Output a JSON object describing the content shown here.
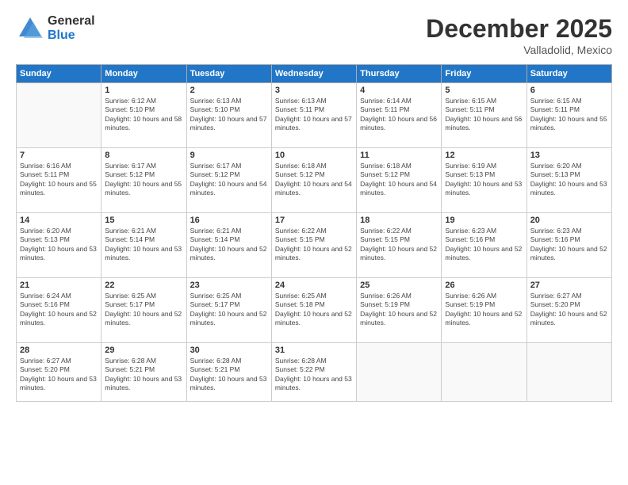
{
  "logo": {
    "general": "General",
    "blue": "Blue"
  },
  "title": "December 2025",
  "subtitle": "Valladolid, Mexico",
  "days_of_week": [
    "Sunday",
    "Monday",
    "Tuesday",
    "Wednesday",
    "Thursday",
    "Friday",
    "Saturday"
  ],
  "weeks": [
    [
      {
        "day": "",
        "sunrise": "",
        "sunset": "",
        "daylight": ""
      },
      {
        "day": "1",
        "sunrise": "Sunrise: 6:12 AM",
        "sunset": "Sunset: 5:10 PM",
        "daylight": "Daylight: 10 hours and 58 minutes."
      },
      {
        "day": "2",
        "sunrise": "Sunrise: 6:13 AM",
        "sunset": "Sunset: 5:10 PM",
        "daylight": "Daylight: 10 hours and 57 minutes."
      },
      {
        "day": "3",
        "sunrise": "Sunrise: 6:13 AM",
        "sunset": "Sunset: 5:11 PM",
        "daylight": "Daylight: 10 hours and 57 minutes."
      },
      {
        "day": "4",
        "sunrise": "Sunrise: 6:14 AM",
        "sunset": "Sunset: 5:11 PM",
        "daylight": "Daylight: 10 hours and 56 minutes."
      },
      {
        "day": "5",
        "sunrise": "Sunrise: 6:15 AM",
        "sunset": "Sunset: 5:11 PM",
        "daylight": "Daylight: 10 hours and 56 minutes."
      },
      {
        "day": "6",
        "sunrise": "Sunrise: 6:15 AM",
        "sunset": "Sunset: 5:11 PM",
        "daylight": "Daylight: 10 hours and 55 minutes."
      }
    ],
    [
      {
        "day": "7",
        "sunrise": "Sunrise: 6:16 AM",
        "sunset": "Sunset: 5:11 PM",
        "daylight": "Daylight: 10 hours and 55 minutes."
      },
      {
        "day": "8",
        "sunrise": "Sunrise: 6:17 AM",
        "sunset": "Sunset: 5:12 PM",
        "daylight": "Daylight: 10 hours and 55 minutes."
      },
      {
        "day": "9",
        "sunrise": "Sunrise: 6:17 AM",
        "sunset": "Sunset: 5:12 PM",
        "daylight": "Daylight: 10 hours and 54 minutes."
      },
      {
        "day": "10",
        "sunrise": "Sunrise: 6:18 AM",
        "sunset": "Sunset: 5:12 PM",
        "daylight": "Daylight: 10 hours and 54 minutes."
      },
      {
        "day": "11",
        "sunrise": "Sunrise: 6:18 AM",
        "sunset": "Sunset: 5:12 PM",
        "daylight": "Daylight: 10 hours and 54 minutes."
      },
      {
        "day": "12",
        "sunrise": "Sunrise: 6:19 AM",
        "sunset": "Sunset: 5:13 PM",
        "daylight": "Daylight: 10 hours and 53 minutes."
      },
      {
        "day": "13",
        "sunrise": "Sunrise: 6:20 AM",
        "sunset": "Sunset: 5:13 PM",
        "daylight": "Daylight: 10 hours and 53 minutes."
      }
    ],
    [
      {
        "day": "14",
        "sunrise": "Sunrise: 6:20 AM",
        "sunset": "Sunset: 5:13 PM",
        "daylight": "Daylight: 10 hours and 53 minutes."
      },
      {
        "day": "15",
        "sunrise": "Sunrise: 6:21 AM",
        "sunset": "Sunset: 5:14 PM",
        "daylight": "Daylight: 10 hours and 53 minutes."
      },
      {
        "day": "16",
        "sunrise": "Sunrise: 6:21 AM",
        "sunset": "Sunset: 5:14 PM",
        "daylight": "Daylight: 10 hours and 52 minutes."
      },
      {
        "day": "17",
        "sunrise": "Sunrise: 6:22 AM",
        "sunset": "Sunset: 5:15 PM",
        "daylight": "Daylight: 10 hours and 52 minutes."
      },
      {
        "day": "18",
        "sunrise": "Sunrise: 6:22 AM",
        "sunset": "Sunset: 5:15 PM",
        "daylight": "Daylight: 10 hours and 52 minutes."
      },
      {
        "day": "19",
        "sunrise": "Sunrise: 6:23 AM",
        "sunset": "Sunset: 5:16 PM",
        "daylight": "Daylight: 10 hours and 52 minutes."
      },
      {
        "day": "20",
        "sunrise": "Sunrise: 6:23 AM",
        "sunset": "Sunset: 5:16 PM",
        "daylight": "Daylight: 10 hours and 52 minutes."
      }
    ],
    [
      {
        "day": "21",
        "sunrise": "Sunrise: 6:24 AM",
        "sunset": "Sunset: 5:16 PM",
        "daylight": "Daylight: 10 hours and 52 minutes."
      },
      {
        "day": "22",
        "sunrise": "Sunrise: 6:25 AM",
        "sunset": "Sunset: 5:17 PM",
        "daylight": "Daylight: 10 hours and 52 minutes."
      },
      {
        "day": "23",
        "sunrise": "Sunrise: 6:25 AM",
        "sunset": "Sunset: 5:17 PM",
        "daylight": "Daylight: 10 hours and 52 minutes."
      },
      {
        "day": "24",
        "sunrise": "Sunrise: 6:25 AM",
        "sunset": "Sunset: 5:18 PM",
        "daylight": "Daylight: 10 hours and 52 minutes."
      },
      {
        "day": "25",
        "sunrise": "Sunrise: 6:26 AM",
        "sunset": "Sunset: 5:19 PM",
        "daylight": "Daylight: 10 hours and 52 minutes."
      },
      {
        "day": "26",
        "sunrise": "Sunrise: 6:26 AM",
        "sunset": "Sunset: 5:19 PM",
        "daylight": "Daylight: 10 hours and 52 minutes."
      },
      {
        "day": "27",
        "sunrise": "Sunrise: 6:27 AM",
        "sunset": "Sunset: 5:20 PM",
        "daylight": "Daylight: 10 hours and 52 minutes."
      }
    ],
    [
      {
        "day": "28",
        "sunrise": "Sunrise: 6:27 AM",
        "sunset": "Sunset: 5:20 PM",
        "daylight": "Daylight: 10 hours and 53 minutes."
      },
      {
        "day": "29",
        "sunrise": "Sunrise: 6:28 AM",
        "sunset": "Sunset: 5:21 PM",
        "daylight": "Daylight: 10 hours and 53 minutes."
      },
      {
        "day": "30",
        "sunrise": "Sunrise: 6:28 AM",
        "sunset": "Sunset: 5:21 PM",
        "daylight": "Daylight: 10 hours and 53 minutes."
      },
      {
        "day": "31",
        "sunrise": "Sunrise: 6:28 AM",
        "sunset": "Sunset: 5:22 PM",
        "daylight": "Daylight: 10 hours and 53 minutes."
      },
      {
        "day": "",
        "sunrise": "",
        "sunset": "",
        "daylight": ""
      },
      {
        "day": "",
        "sunrise": "",
        "sunset": "",
        "daylight": ""
      },
      {
        "day": "",
        "sunrise": "",
        "sunset": "",
        "daylight": ""
      }
    ]
  ]
}
